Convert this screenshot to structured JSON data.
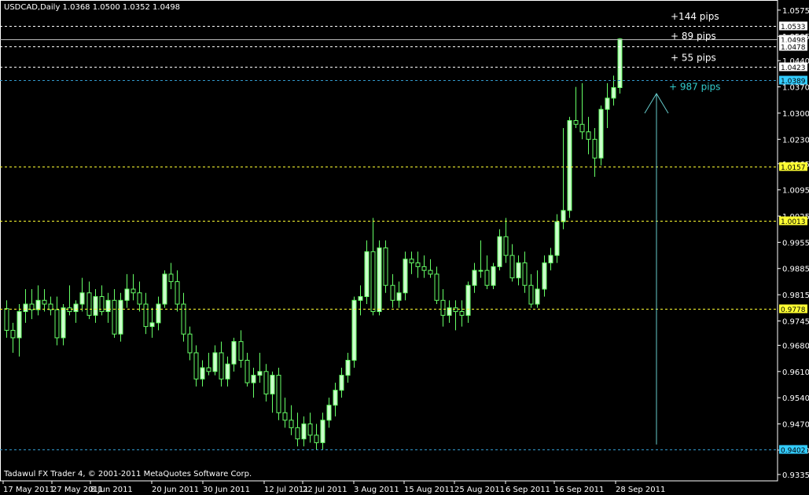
{
  "header": {
    "symbol_line": "USDCAD,Daily  1.0368 1.0500 1.0352 1.0498"
  },
  "footer": {
    "copyright": "Tadawul FX Trader 4, © 2001-2011 MetaQuotes Software Corp."
  },
  "colors": {
    "background": "#000000",
    "axis": "#ffffff",
    "bull_candle": "#ccffcc",
    "bear_candle": "#000000",
    "wick": "#66ff66",
    "level_yellow": "#ffff33",
    "level_white": "#ffffff",
    "level_cyan": "#3399cc",
    "arrow": "#66cccc",
    "annotation_cyan": "#33cccc"
  },
  "chart_data": {
    "type": "candlestick",
    "symbol": "USDCAD",
    "timeframe": "Daily",
    "last_bar": {
      "open": 1.0368,
      "high": 1.05,
      "low": 1.0352,
      "close": 1.0498
    },
    "y_ticks": [
      "1.0575",
      "1.0505",
      "1.0440",
      "1.0370",
      "1.0300",
      "1.0230",
      "1.0165",
      "1.0095",
      "1.0025",
      "0.9955",
      "0.9885",
      "0.9815",
      "0.9745",
      "0.9680",
      "0.9610",
      "0.9540",
      "0.9470",
      "0.9400",
      "0.9335"
    ],
    "ylim": [
      0.9318,
      1.0602
    ],
    "x_ticks": [
      "17 May 2011",
      "27 May 2011",
      "8 Jun 2011",
      "20 Jun 2011",
      "30 Jun 2011",
      "12 Jul 2011",
      "22 Jul 2011",
      "3 Aug 2011",
      "15 Aug 2011",
      "25 Aug 2011",
      "6 Sep 2011",
      "16 Sep 2011",
      "28 Sep 2011"
    ],
    "levels": [
      {
        "price": 1.0533,
        "label": "1.0533",
        "kind": "white"
      },
      {
        "price": 1.0498,
        "label": "1.0498",
        "kind": "current"
      },
      {
        "price": 1.0478,
        "label": "1.0478",
        "kind": "white"
      },
      {
        "price": 1.0423,
        "label": "1.0423",
        "kind": "white"
      },
      {
        "price": 1.0389,
        "label": "1.0389",
        "kind": "cyan"
      },
      {
        "price": 1.0157,
        "label": "1.0157",
        "kind": "yellow"
      },
      {
        "price": 1.0013,
        "label": "1.0013",
        "kind": "yellow"
      },
      {
        "price": 0.9778,
        "label": "0.9778",
        "kind": "yellow"
      },
      {
        "price": 0.9402,
        "label": "0.9402",
        "kind": "cyan"
      }
    ],
    "annotations": [
      {
        "text": "+144 pips",
        "price": 1.0558,
        "color": "white"
      },
      {
        "text": "+ 89 pips",
        "price": 1.0505,
        "color": "white"
      },
      {
        "text": "+ 55 pips",
        "price": 1.0448,
        "color": "white"
      },
      {
        "text": "+ 987 pips",
        "price": 1.037,
        "color": "cyan"
      }
    ],
    "arrow": {
      "from": 0.9415,
      "to": 1.0352
    },
    "candles": [
      {
        "o": 0.9778,
        "h": 0.98,
        "l": 0.97,
        "c": 0.972
      },
      {
        "o": 0.972,
        "h": 0.974,
        "l": 0.966,
        "c": 0.97
      },
      {
        "o": 0.97,
        "h": 0.979,
        "l": 0.965,
        "c": 0.977
      },
      {
        "o": 0.977,
        "h": 0.983,
        "l": 0.974,
        "c": 0.979
      },
      {
        "o": 0.979,
        "h": 0.983,
        "l": 0.975,
        "c": 0.9775
      },
      {
        "o": 0.9775,
        "h": 0.984,
        "l": 0.976,
        "c": 0.98
      },
      {
        "o": 0.98,
        "h": 0.983,
        "l": 0.977,
        "c": 0.979
      },
      {
        "o": 0.979,
        "h": 0.981,
        "l": 0.976,
        "c": 0.9775
      },
      {
        "o": 0.9775,
        "h": 0.981,
        "l": 0.968,
        "c": 0.97
      },
      {
        "o": 0.97,
        "h": 0.979,
        "l": 0.968,
        "c": 0.978
      },
      {
        "o": 0.978,
        "h": 0.984,
        "l": 0.976,
        "c": 0.977
      },
      {
        "o": 0.977,
        "h": 0.98,
        "l": 0.974,
        "c": 0.979
      },
      {
        "o": 0.979,
        "h": 0.986,
        "l": 0.977,
        "c": 0.982
      },
      {
        "o": 0.982,
        "h": 0.985,
        "l": 0.975,
        "c": 0.976
      },
      {
        "o": 0.976,
        "h": 0.983,
        "l": 0.974,
        "c": 0.981
      },
      {
        "o": 0.981,
        "h": 0.984,
        "l": 0.976,
        "c": 0.977
      },
      {
        "o": 0.977,
        "h": 0.982,
        "l": 0.974,
        "c": 0.98
      },
      {
        "o": 0.98,
        "h": 0.983,
        "l": 0.97,
        "c": 0.971
      },
      {
        "o": 0.971,
        "h": 0.982,
        "l": 0.969,
        "c": 0.98
      },
      {
        "o": 0.98,
        "h": 0.987,
        "l": 0.978,
        "c": 0.983
      },
      {
        "o": 0.983,
        "h": 0.987,
        "l": 0.98,
        "c": 0.982
      },
      {
        "o": 0.982,
        "h": 0.985,
        "l": 0.977,
        "c": 0.979
      },
      {
        "o": 0.979,
        "h": 0.982,
        "l": 0.971,
        "c": 0.973
      },
      {
        "o": 0.973,
        "h": 0.978,
        "l": 0.97,
        "c": 0.974
      },
      {
        "o": 0.974,
        "h": 0.981,
        "l": 0.972,
        "c": 0.979
      },
      {
        "o": 0.979,
        "h": 0.988,
        "l": 0.978,
        "c": 0.987
      },
      {
        "o": 0.987,
        "h": 0.99,
        "l": 0.983,
        "c": 0.985
      },
      {
        "o": 0.985,
        "h": 0.988,
        "l": 0.977,
        "c": 0.979
      },
      {
        "o": 0.979,
        "h": 0.982,
        "l": 0.969,
        "c": 0.971
      },
      {
        "o": 0.971,
        "h": 0.973,
        "l": 0.964,
        "c": 0.966
      },
      {
        "o": 0.966,
        "h": 0.968,
        "l": 0.957,
        "c": 0.959
      },
      {
        "o": 0.959,
        "h": 0.964,
        "l": 0.957,
        "c": 0.962
      },
      {
        "o": 0.962,
        "h": 0.966,
        "l": 0.96,
        "c": 0.961
      },
      {
        "o": 0.961,
        "h": 0.968,
        "l": 0.96,
        "c": 0.966
      },
      {
        "o": 0.966,
        "h": 0.969,
        "l": 0.957,
        "c": 0.959
      },
      {
        "o": 0.959,
        "h": 0.965,
        "l": 0.957,
        "c": 0.963
      },
      {
        "o": 0.963,
        "h": 0.97,
        "l": 0.961,
        "c": 0.969
      },
      {
        "o": 0.969,
        "h": 0.972,
        "l": 0.962,
        "c": 0.964
      },
      {
        "o": 0.964,
        "h": 0.966,
        "l": 0.957,
        "c": 0.958
      },
      {
        "o": 0.958,
        "h": 0.962,
        "l": 0.954,
        "c": 0.96
      },
      {
        "o": 0.96,
        "h": 0.966,
        "l": 0.958,
        "c": 0.961
      },
      {
        "o": 0.961,
        "h": 0.963,
        "l": 0.953,
        "c": 0.955
      },
      {
        "o": 0.955,
        "h": 0.961,
        "l": 0.95,
        "c": 0.96
      },
      {
        "o": 0.96,
        "h": 0.962,
        "l": 0.948,
        "c": 0.95
      },
      {
        "o": 0.95,
        "h": 0.954,
        "l": 0.946,
        "c": 0.948
      },
      {
        "o": 0.948,
        "h": 0.952,
        "l": 0.944,
        "c": 0.946
      },
      {
        "o": 0.946,
        "h": 0.95,
        "l": 0.941,
        "c": 0.943
      },
      {
        "o": 0.943,
        "h": 0.949,
        "l": 0.941,
        "c": 0.947
      },
      {
        "o": 0.947,
        "h": 0.95,
        "l": 0.942,
        "c": 0.944
      },
      {
        "o": 0.944,
        "h": 0.947,
        "l": 0.94,
        "c": 0.942
      },
      {
        "o": 0.942,
        "h": 0.95,
        "l": 0.94,
        "c": 0.948
      },
      {
        "o": 0.948,
        "h": 0.954,
        "l": 0.946,
        "c": 0.952
      },
      {
        "o": 0.952,
        "h": 0.958,
        "l": 0.949,
        "c": 0.956
      },
      {
        "o": 0.956,
        "h": 0.962,
        "l": 0.954,
        "c": 0.96
      },
      {
        "o": 0.96,
        "h": 0.966,
        "l": 0.958,
        "c": 0.964
      },
      {
        "o": 0.964,
        "h": 0.981,
        "l": 0.962,
        "c": 0.98
      },
      {
        "o": 0.98,
        "h": 0.984,
        "l": 0.976,
        "c": 0.981
      },
      {
        "o": 0.981,
        "h": 0.996,
        "l": 0.979,
        "c": 0.993
      },
      {
        "o": 0.993,
        "h": 1.002,
        "l": 0.976,
        "c": 0.977
      },
      {
        "o": 0.977,
        "h": 0.996,
        "l": 0.976,
        "c": 0.994
      },
      {
        "o": 0.994,
        "h": 0.996,
        "l": 0.982,
        "c": 0.984
      },
      {
        "o": 0.984,
        "h": 0.987,
        "l": 0.978,
        "c": 0.98
      },
      {
        "o": 0.98,
        "h": 0.985,
        "l": 0.978,
        "c": 0.982
      },
      {
        "o": 0.982,
        "h": 0.993,
        "l": 0.98,
        "c": 0.991
      },
      {
        "o": 0.991,
        "h": 0.993,
        "l": 0.987,
        "c": 0.99
      },
      {
        "o": 0.99,
        "h": 0.993,
        "l": 0.986,
        "c": 0.989
      },
      {
        "o": 0.989,
        "h": 0.992,
        "l": 0.986,
        "c": 0.988
      },
      {
        "o": 0.988,
        "h": 0.991,
        "l": 0.986,
        "c": 0.987
      },
      {
        "o": 0.987,
        "h": 0.989,
        "l": 0.979,
        "c": 0.98
      },
      {
        "o": 0.98,
        "h": 0.983,
        "l": 0.973,
        "c": 0.976
      },
      {
        "o": 0.976,
        "h": 0.98,
        "l": 0.974,
        "c": 0.978
      },
      {
        "o": 0.978,
        "h": 0.98,
        "l": 0.972,
        "c": 0.977
      },
      {
        "o": 0.977,
        "h": 0.98,
        "l": 0.973,
        "c": 0.976
      },
      {
        "o": 0.976,
        "h": 0.985,
        "l": 0.974,
        "c": 0.984
      },
      {
        "o": 0.984,
        "h": 0.99,
        "l": 0.982,
        "c": 0.988
      },
      {
        "o": 0.988,
        "h": 0.996,
        "l": 0.986,
        "c": 0.988
      },
      {
        "o": 0.988,
        "h": 0.992,
        "l": 0.983,
        "c": 0.984
      },
      {
        "o": 0.984,
        "h": 0.99,
        "l": 0.983,
        "c": 0.989
      },
      {
        "o": 0.989,
        "h": 0.999,
        "l": 0.988,
        "c": 0.997
      },
      {
        "o": 0.997,
        "h": 1.002,
        "l": 0.99,
        "c": 0.992
      },
      {
        "o": 0.992,
        "h": 0.995,
        "l": 0.985,
        "c": 0.986
      },
      {
        "o": 0.986,
        "h": 0.992,
        "l": 0.984,
        "c": 0.99
      },
      {
        "o": 0.99,
        "h": 0.993,
        "l": 0.982,
        "c": 0.984
      },
      {
        "o": 0.984,
        "h": 0.987,
        "l": 0.978,
        "c": 0.979
      },
      {
        "o": 0.979,
        "h": 0.988,
        "l": 0.978,
        "c": 0.983
      },
      {
        "o": 0.983,
        "h": 0.992,
        "l": 0.981,
        "c": 0.99
      },
      {
        "o": 0.99,
        "h": 0.994,
        "l": 0.988,
        "c": 0.992
      },
      {
        "o": 0.992,
        "h": 1.003,
        "l": 0.99,
        "c": 1.001
      },
      {
        "o": 1.001,
        "h": 1.026,
        "l": 0.999,
        "c": 1.004
      },
      {
        "o": 1.004,
        "h": 1.029,
        "l": 1.002,
        "c": 1.028
      },
      {
        "o": 1.028,
        "h": 1.037,
        "l": 1.026,
        "c": 1.027
      },
      {
        "o": 1.027,
        "h": 1.038,
        "l": 1.023,
        "c": 1.025
      },
      {
        "o": 1.025,
        "h": 1.029,
        "l": 1.019,
        "c": 1.023
      },
      {
        "o": 1.023,
        "h": 1.026,
        "l": 1.013,
        "c": 1.018
      },
      {
        "o": 1.018,
        "h": 1.032,
        "l": 1.016,
        "c": 1.031
      },
      {
        "o": 1.031,
        "h": 1.038,
        "l": 1.026,
        "c": 1.034
      },
      {
        "o": 1.034,
        "h": 1.04,
        "l": 1.032,
        "c": 1.0368
      },
      {
        "o": 1.0368,
        "h": 1.05,
        "l": 1.0352,
        "c": 1.0498
      }
    ]
  }
}
